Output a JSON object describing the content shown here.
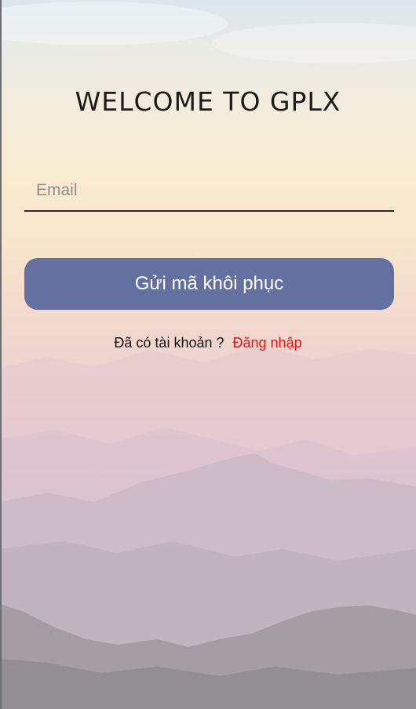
{
  "header": {
    "title": "WELCOME TO GPLX"
  },
  "form": {
    "email_placeholder": "Email",
    "email_value": "",
    "submit_label": "Gửi mã khôi phục"
  },
  "footer": {
    "prompt": "Đã có tài khoản ?",
    "login_link": "Đăng nhập"
  },
  "colors": {
    "button": "#6470a0",
    "link": "#ee1111",
    "title": "#1c1c1c"
  }
}
